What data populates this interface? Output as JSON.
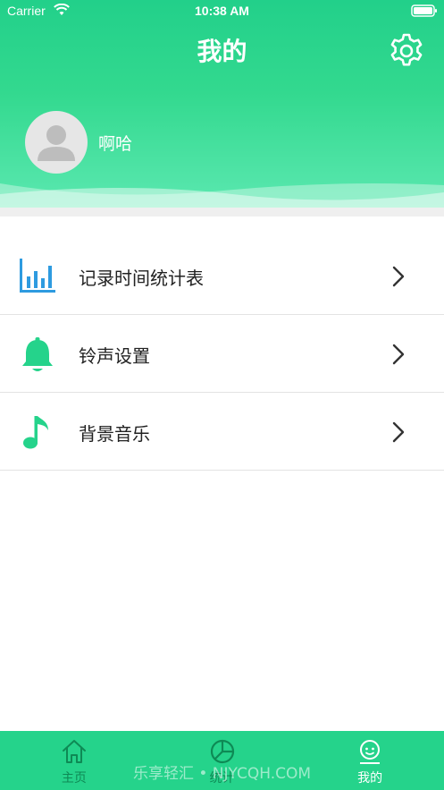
{
  "status_bar": {
    "carrier": "Carrier",
    "time": "10:38 AM"
  },
  "header": {
    "title": "我的",
    "settings_icon": "gear-icon"
  },
  "profile": {
    "username": "啊哈",
    "avatar_icon": "user-avatar-icon"
  },
  "menu": {
    "items": [
      {
        "label": "记录时间统计表",
        "icon": "bar-chart-icon"
      },
      {
        "label": "铃声设置",
        "icon": "bell-icon"
      },
      {
        "label": "背景音乐",
        "icon": "music-note-icon"
      }
    ]
  },
  "tabbar": {
    "tabs": [
      {
        "label": "主页",
        "icon": "home-icon",
        "active": false
      },
      {
        "label": "统计",
        "icon": "pie-chart-icon",
        "active": false
      },
      {
        "label": "我的",
        "icon": "smiley-icon",
        "active": true
      }
    ]
  },
  "watermark": "乐享轻汇 • NJYCQH.COM",
  "colors": {
    "accent": "#25d38b",
    "chart_icon": "#2e9be0",
    "text": "#222222"
  }
}
